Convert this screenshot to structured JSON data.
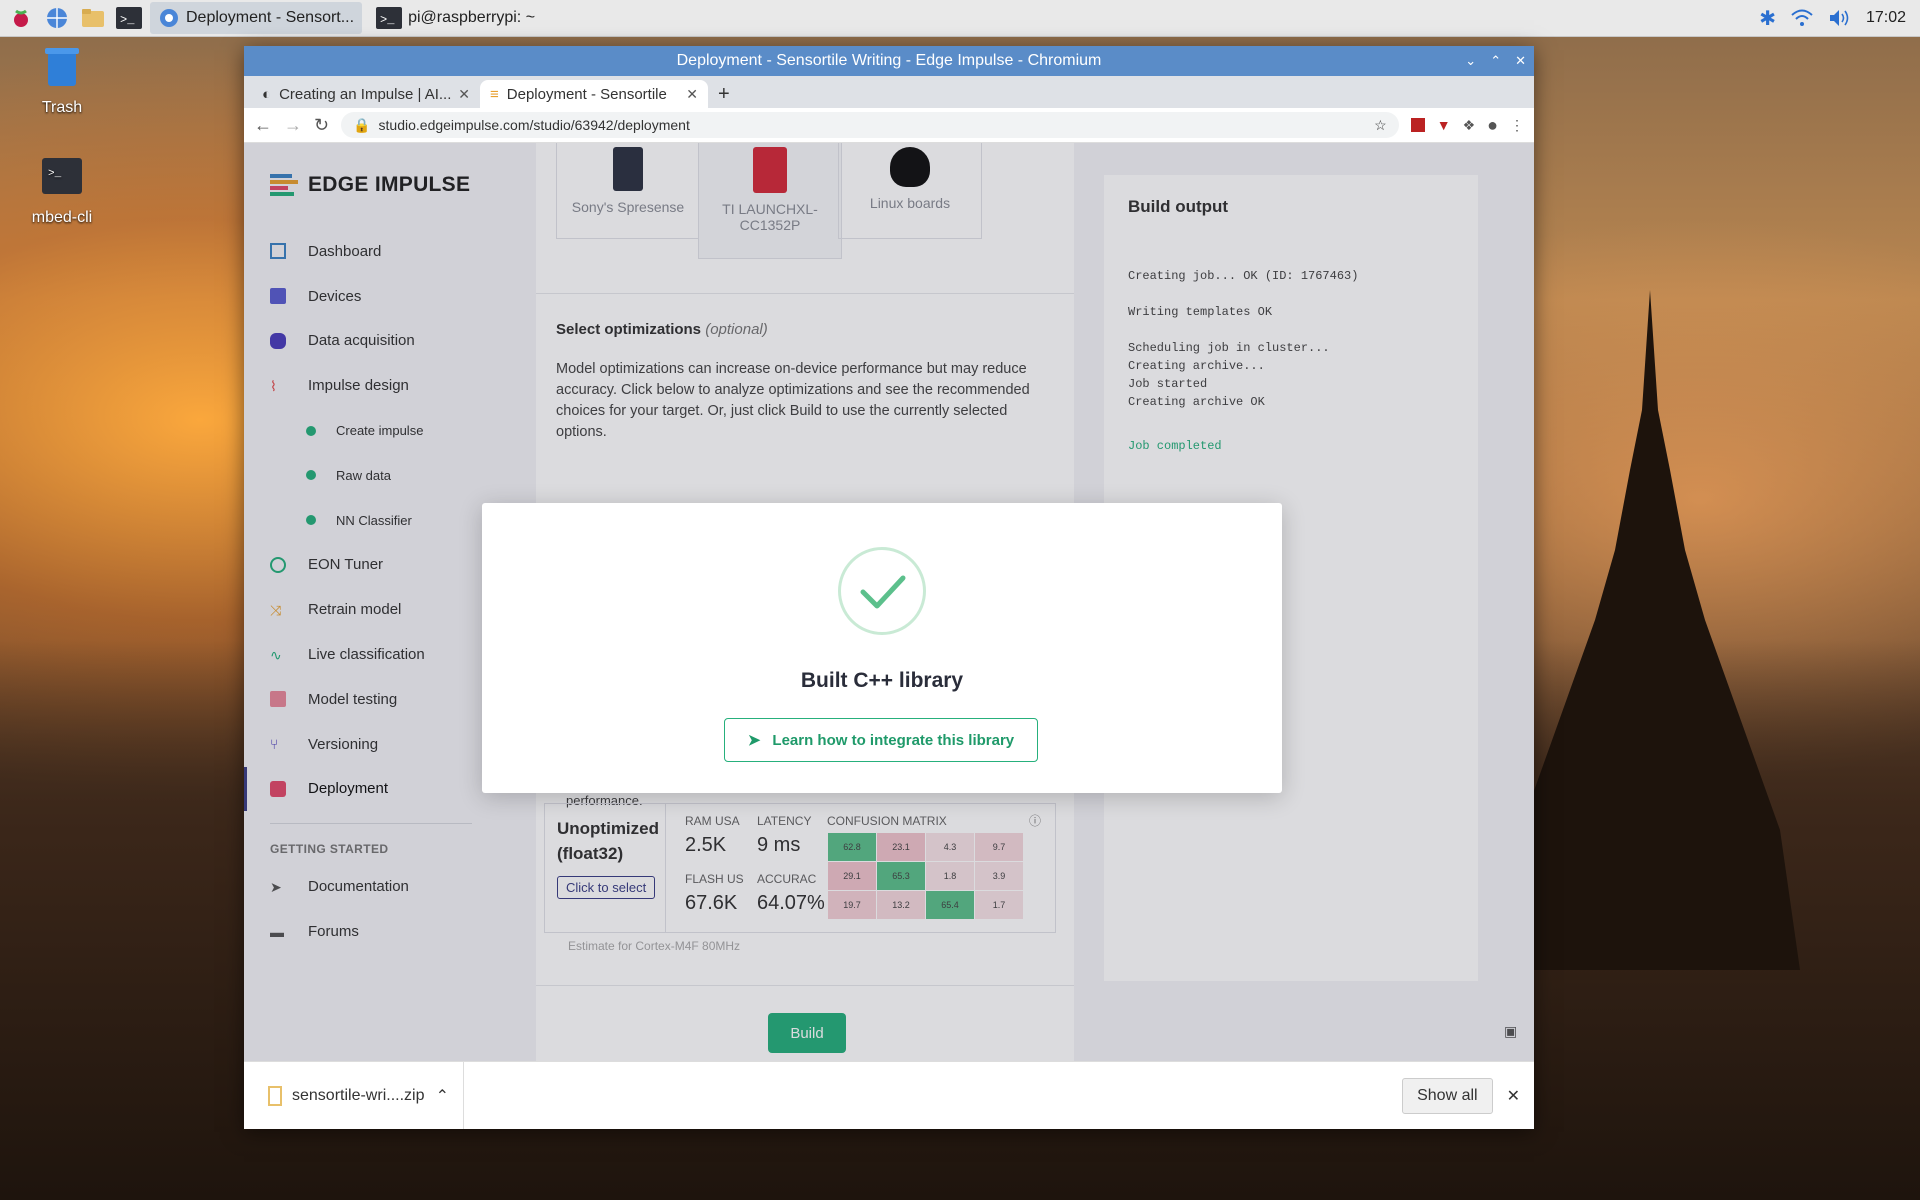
{
  "taskbar": {
    "tasks": [
      {
        "label": "Deployment - Sensort..."
      },
      {
        "label": "pi@raspberrypi: ~"
      }
    ],
    "clock": "17:02"
  },
  "desktop": {
    "icons": [
      {
        "label": "Trash"
      },
      {
        "label": "mbed-cli"
      }
    ]
  },
  "window": {
    "title": "Deployment - Sensortile Writing - Edge Impulse - Chromium",
    "tabs": [
      {
        "label": "Creating an Impulse | AI..."
      },
      {
        "label": "Deployment - Sensortile"
      }
    ],
    "url": "studio.edgeimpulse.com/studio/63942/deployment"
  },
  "sidebar": {
    "logo": "EDGE IMPULSE",
    "items": [
      {
        "label": "Dashboard"
      },
      {
        "label": "Devices"
      },
      {
        "label": "Data acquisition"
      },
      {
        "label": "Impulse design"
      },
      {
        "label": "Create impulse"
      },
      {
        "label": "Raw data"
      },
      {
        "label": "NN Classifier"
      },
      {
        "label": "EON Tuner"
      },
      {
        "label": "Retrain model"
      },
      {
        "label": "Live classification"
      },
      {
        "label": "Model testing"
      },
      {
        "label": "Versioning"
      },
      {
        "label": "Deployment"
      }
    ],
    "section_label": "GETTING STARTED",
    "extra": [
      {
        "label": "Documentation"
      },
      {
        "label": "Forums"
      }
    ]
  },
  "main": {
    "boards": [
      {
        "label": "Sony's Spresense"
      },
      {
        "label": "TI LAUNCHXL-CC1352P"
      },
      {
        "label": "Linux boards"
      }
    ],
    "optim_title": "Select optimizations",
    "optim_optional": "(optional)",
    "optim_desc": "Model optimizations can increase on-device performance but may reduce accuracy. Click below to analyze optimizations and see the recommended choices for your target. Or, just click Build to use the currently selected options.",
    "recommend_text": "is recommended for best performance.",
    "unopt": {
      "title": "Unoptimized (float32)",
      "select_label": "Click to select",
      "ram_label": "RAM USA",
      "ram_value": "2.5K",
      "latency_label": "LATENCY",
      "latency_value": "9 ms",
      "flash_label": "FLASH US",
      "flash_value": "67.6K",
      "accuracy_label": "ACCURAC",
      "accuracy_value": "64.07%",
      "cm_label": "CONFUSION MATRIX",
      "cm": [
        [
          "62.8",
          "23.1",
          "4.3",
          "9.7"
        ],
        [
          "29.1",
          "65.3",
          "1.8",
          "3.9"
        ],
        [
          "19.7",
          "13.2",
          "65.4",
          "1.7"
        ]
      ]
    },
    "estimate": "Estimate for Cortex-M4F 80MHz",
    "build_label": "Build"
  },
  "output": {
    "title": "Build output",
    "log": "Creating job... OK (ID: 1767463)\n\nWriting templates OK\n\nScheduling job in cluster...\nCreating archive...\nJob started\nCreating archive OK",
    "done": "Job completed"
  },
  "modal": {
    "title": "Built C++ library",
    "button": "Learn how to integrate this library"
  },
  "downloads": {
    "file": "sensortile-wri....zip",
    "show_all": "Show all"
  },
  "colors": {
    "accent": "#26b07c",
    "titlebar": "#5a8cc8",
    "cm_good": "#5cc08c",
    "cm_bad": "#f0c4cc",
    "cm_light": "#f7e3e6"
  }
}
